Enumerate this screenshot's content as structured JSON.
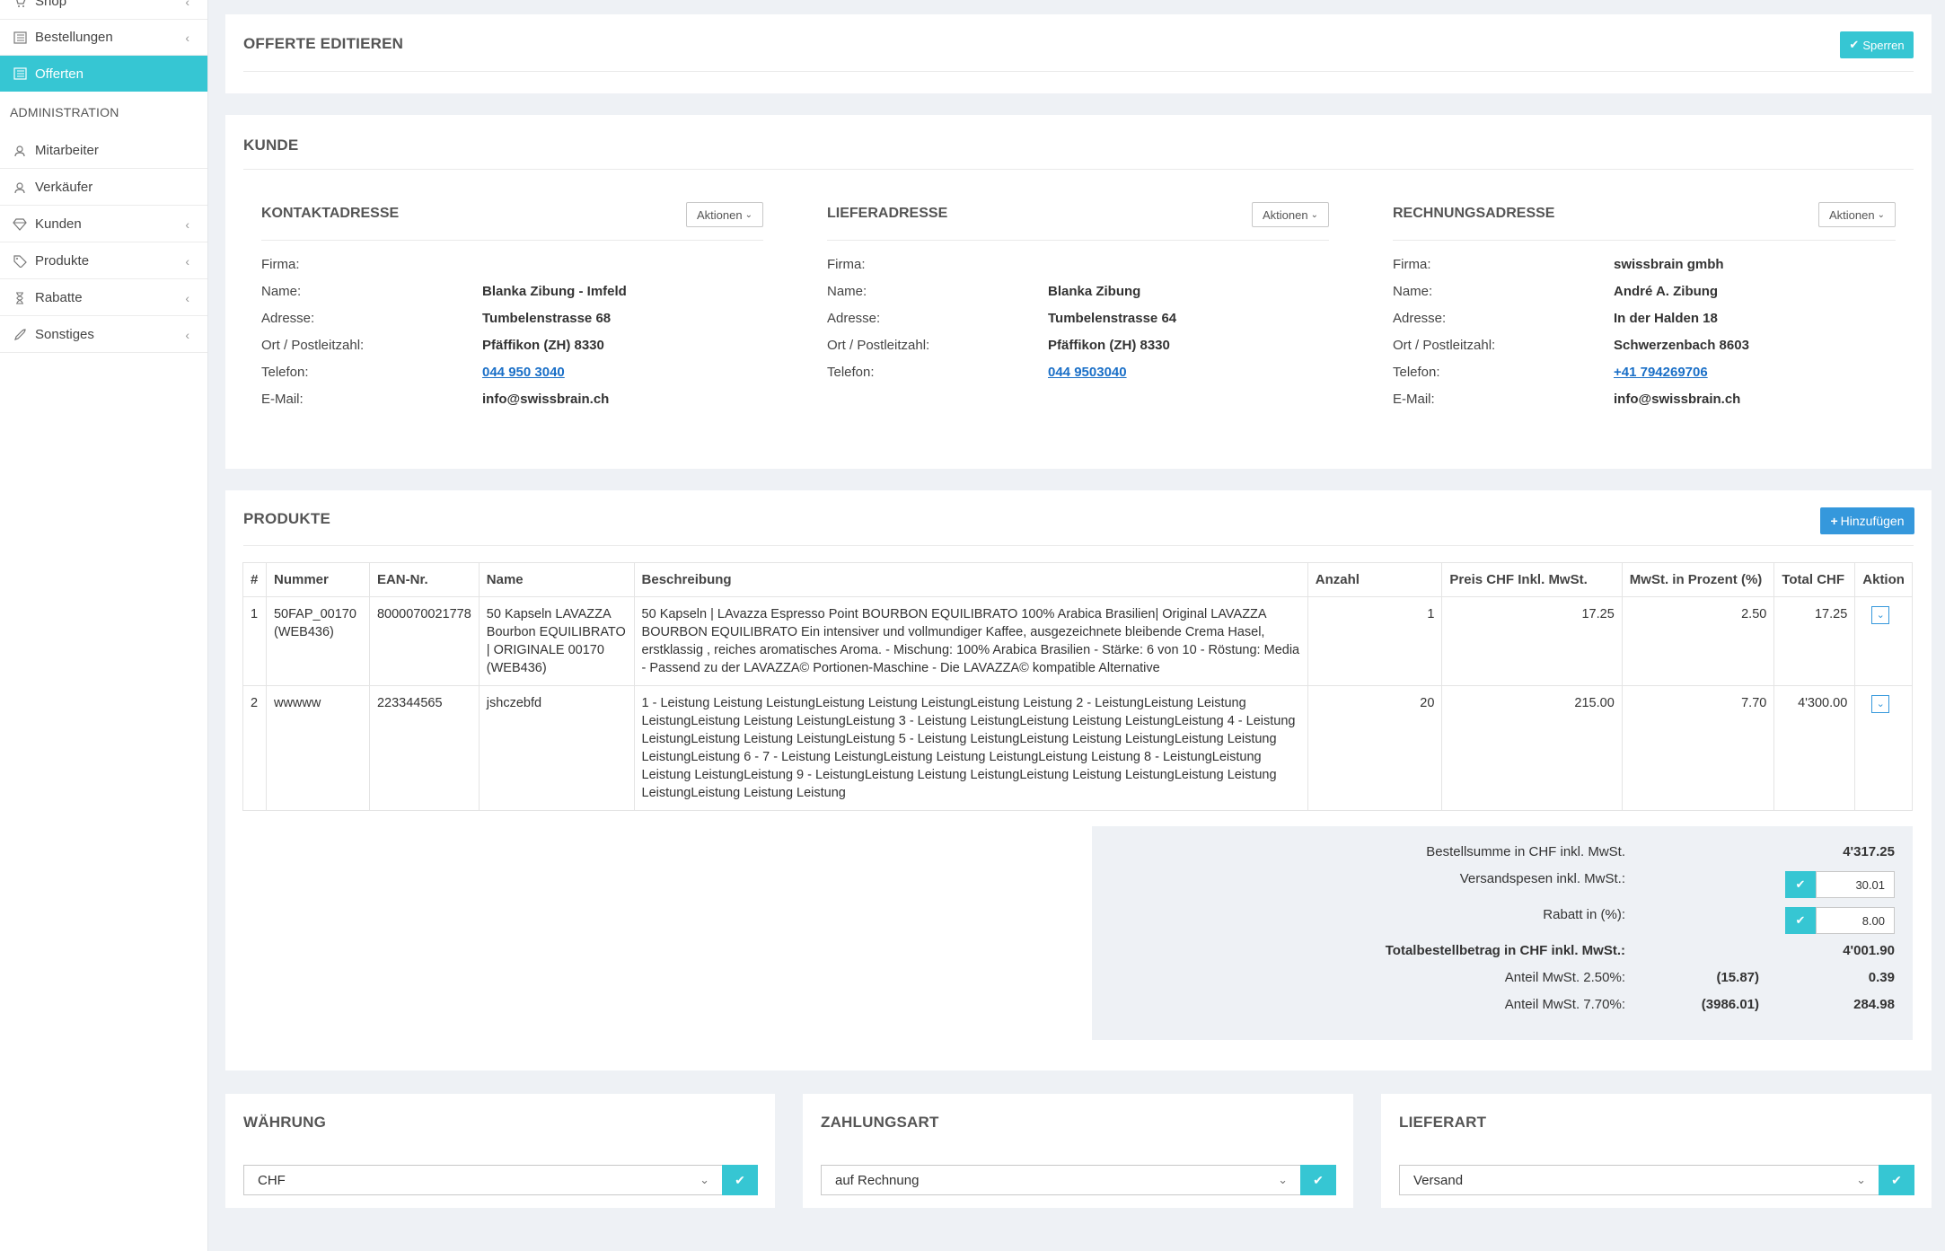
{
  "sidebar": {
    "items": [
      {
        "label": "Shop",
        "icon": "cart-icon"
      },
      {
        "label": "Bestellungen",
        "icon": "list-icon"
      },
      {
        "label": "Offerten",
        "icon": "list-icon"
      }
    ],
    "section_heading": "ADMINISTRATION",
    "admin_items": [
      {
        "label": "Mitarbeiter",
        "icon": "users-icon"
      },
      {
        "label": "Verkäufer",
        "icon": "user-icon"
      },
      {
        "label": "Kunden",
        "icon": "diamond-icon"
      },
      {
        "label": "Produkte",
        "icon": "tag-icon"
      },
      {
        "label": "Rabatte",
        "icon": "hourglass-icon"
      },
      {
        "label": "Sonstiges",
        "icon": "rocket-icon"
      }
    ]
  },
  "header": {
    "title": "OFFERTE EDITIEREN",
    "lock_button": "Sperren"
  },
  "customer": {
    "title": "KUNDE",
    "actions_label": "Aktionen",
    "labels": {
      "firma": "Firma:",
      "name": "Name:",
      "adresse": "Adresse:",
      "ort": "Ort / Postleitzahl:",
      "telefon": "Telefon:",
      "email": "E-Mail:"
    },
    "contact": {
      "title": "KONTAKTADRESSE",
      "firma": "",
      "name": "Blanka Zibung - Imfeld",
      "adresse": "Tumbelenstrasse 68",
      "ort": "Pfäffikon (ZH) 8330",
      "telefon": "044 950 3040",
      "email": "info@swissbrain.ch"
    },
    "delivery": {
      "title": "LIEFERADRESSE",
      "firma": "",
      "name": "Blanka Zibung",
      "adresse": "Tumbelenstrasse 64",
      "ort": "Pfäffikon (ZH) 8330",
      "telefon": "044 9503040"
    },
    "billing": {
      "title": "RECHNUNGSADRESSE",
      "firma": "swissbrain gmbh",
      "name": "André A. Zibung",
      "adresse": "In der Halden 18",
      "ort": "Schwerzenbach 8603",
      "telefon": "+41 794269706",
      "email": "info@swissbrain.ch"
    }
  },
  "products": {
    "title": "PRODUKTE",
    "add_button": "Hinzufügen",
    "columns": [
      "#",
      "Nummer",
      "EAN-Nr.",
      "Name",
      "Beschreibung",
      "Anzahl",
      "Preis CHF Inkl. MwSt.",
      "MwSt. in Prozent (%)",
      "Total CHF",
      "Aktion"
    ],
    "rows": [
      {
        "idx": "1",
        "nummer": "50FAP_00170 (WEB436)",
        "ean": "8000070021778",
        "name": "50 Kapseln LAVAZZA Bourbon EQUILIBRATO | ORIGINALE 00170 (WEB436)",
        "beschreibung": "50 Kapseln | LAvazza Espresso Point BOURBON EQUILIBRATO 100% Arabica Brasilien| Original LAVAZZA BOURBON EQUILIBRATO Ein intensiver und vollmundiger Kaffee, ausgezeichnete bleibende Crema Hasel, erstklassig , reiches aromatisches Aroma. - Mischung: 100% Arabica Brasilien - Stärke: 6 von 10 - Röstung: Media - Passend zu der LAVAZZA© Portionen-Maschine - Die LAVAZZA© kompatible Alternative",
        "anzahl": "1",
        "preis": "17.25",
        "mwst": "2.50",
        "total": "17.25"
      },
      {
        "idx": "2",
        "nummer": "wwwww",
        "ean": "223344565",
        "name": "jshczebfd",
        "beschreibung": "1 - Leistung Leistung LeistungLeistung Leistung LeistungLeistung Leistung 2 - LeistungLeistung Leistung LeistungLeistung Leistung LeistungLeistung 3 - Leistung LeistungLeistung Leistung LeistungLeistung 4 - Leistung LeistungLeistung Leistung LeistungLeistung 5 - Leistung LeistungLeistung Leistung LeistungLeistung Leistung LeistungLeistung 6 - 7 - Leistung LeistungLeistung Leistung LeistungLeistung Leistung 8 - LeistungLeistung Leistung LeistungLeistung 9 - LeistungLeistung Leistung LeistungLeistung Leistung LeistungLeistung Leistung LeistungLeistung Leistung Leistung",
        "anzahl": "20",
        "preis": "215.00",
        "mwst": "7.70",
        "total": "4'300.00"
      }
    ]
  },
  "summary": {
    "order_sum_label": "Bestellsumme in CHF inkl. MwSt.",
    "order_sum_value": "4'317.25",
    "shipping_label": "Versandspesen inkl. MwSt.:",
    "shipping_value": "30.01",
    "discount_label": "Rabatt in (%):",
    "discount_value": "8.00",
    "total_label": "Totalbestellbetrag in CHF inkl. MwSt.:",
    "total_value": "4'001.90",
    "vat1_label": "Anteil MwSt. 2.50%:",
    "vat1_base": "(15.87)",
    "vat1_value": "0.39",
    "vat2_label": "Anteil MwSt. 7.70%:",
    "vat2_base": "(3986.01)",
    "vat2_value": "284.98"
  },
  "currency": {
    "title": "WÄHRUNG",
    "value": "CHF"
  },
  "payment": {
    "title": "ZAHLUNGSART",
    "value": "auf Rechnung"
  },
  "delivery_method": {
    "title": "LIEFERART",
    "value": "Versand"
  },
  "colors": {
    "accent": "#36c6d3",
    "primary": "#3598dc",
    "background": "#eef1f5"
  }
}
